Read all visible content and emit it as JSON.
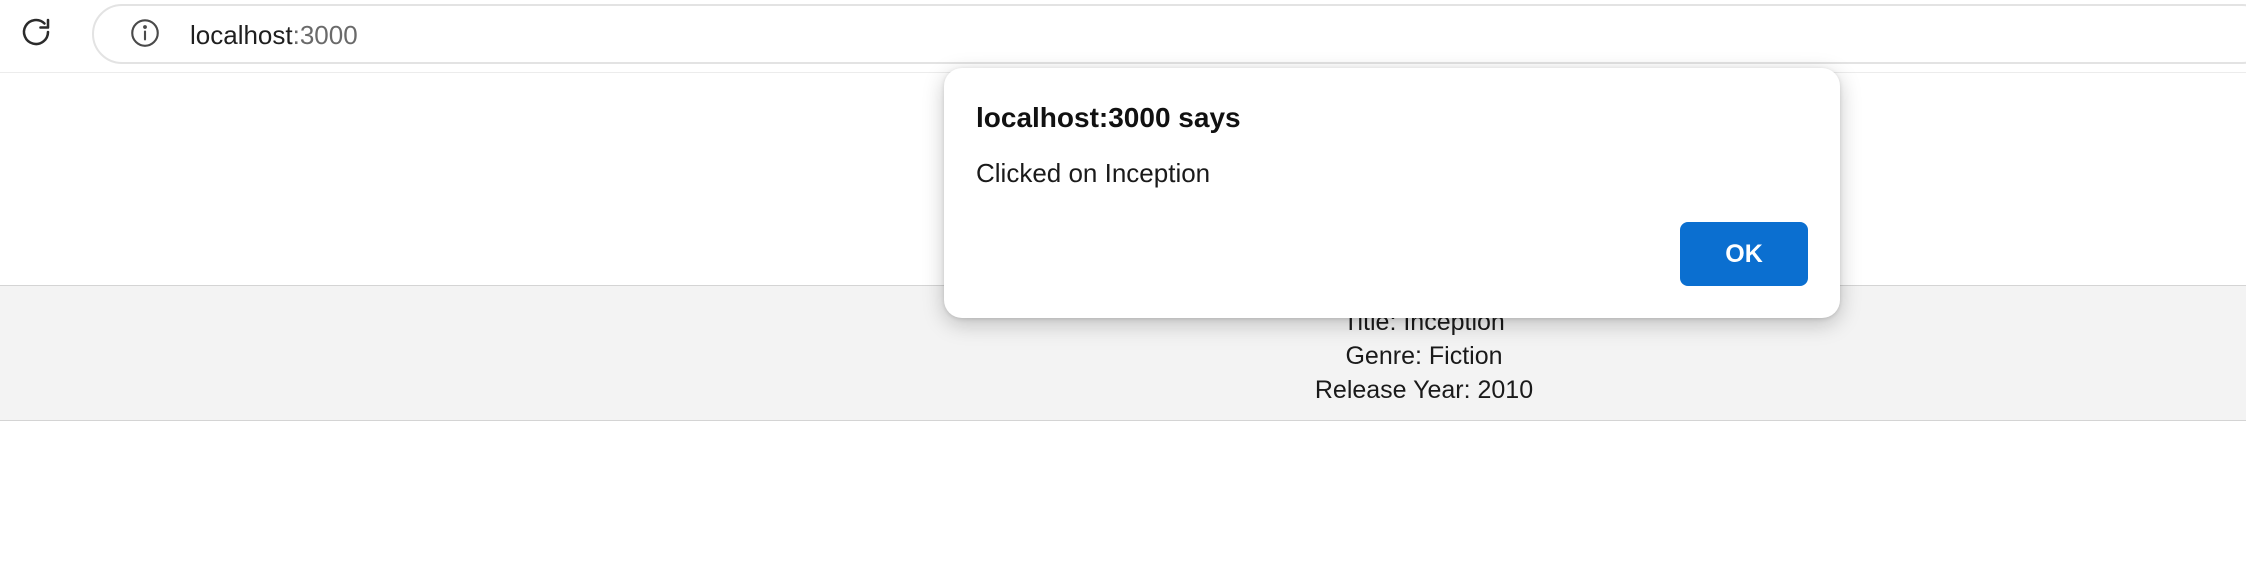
{
  "browser": {
    "url_host": "localhost",
    "url_port": ":3000",
    "reload_icon": "reload-icon",
    "info_icon": "info-icon"
  },
  "movie": {
    "title_label": "Title:",
    "title_value": "Inception",
    "genre_label": "Genre:",
    "genre_value": "Fiction",
    "year_label": "Release Year:",
    "year_value": "2010"
  },
  "dialog": {
    "title": "localhost:3000 says",
    "message": "Clicked on Inception",
    "ok_label": "OK"
  },
  "colors": {
    "accent": "#0b6fd0",
    "card_background": "#f3f3f3"
  }
}
